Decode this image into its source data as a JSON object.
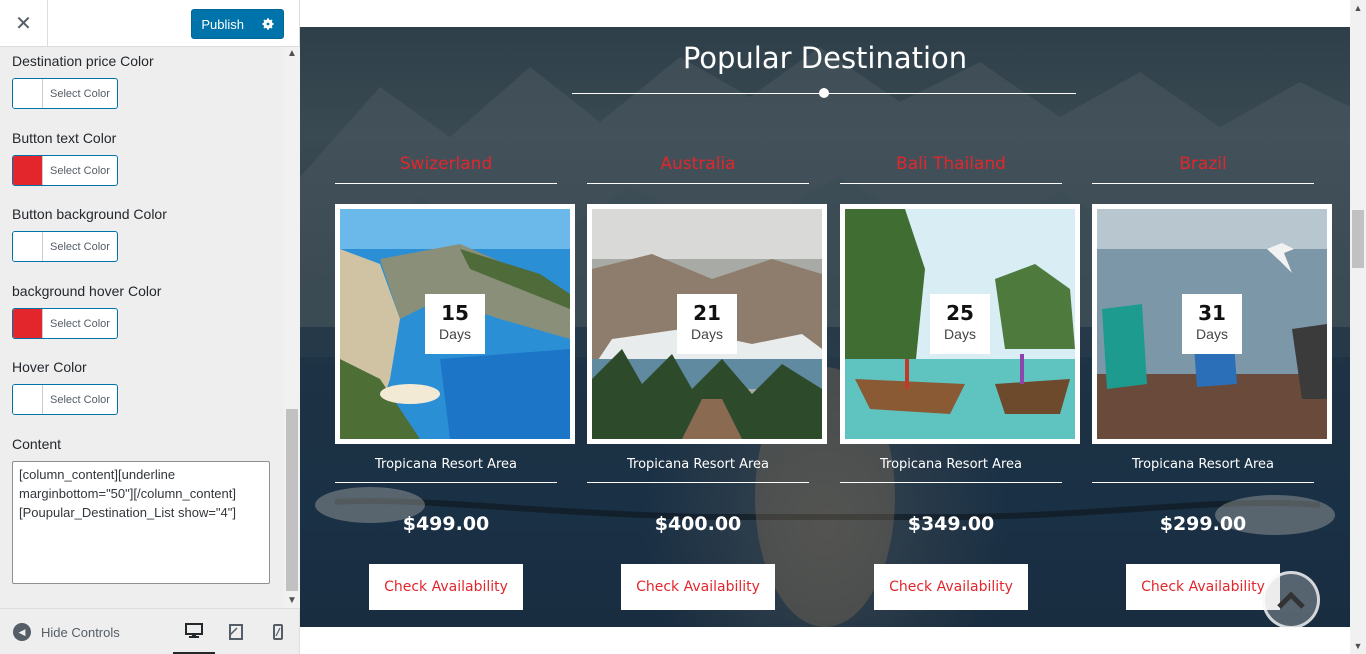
{
  "header": {
    "close_icon": "close-icon",
    "publish_label": "Publish",
    "publish_icon": "gear-icon"
  },
  "controls": [
    {
      "label": "Destination price Color",
      "button_label": "Select Color",
      "swatch_color": "#ffffff"
    },
    {
      "label": "Button text Color",
      "button_label": "Select Color",
      "swatch_color": "#e3262c"
    },
    {
      "label": "Button background Color",
      "button_label": "Select Color",
      "swatch_color": "#ffffff"
    },
    {
      "label": "background hover Color",
      "button_label": "Select Color",
      "swatch_color": "#e3262c"
    },
    {
      "label": "Hover Color",
      "button_label": "Select Color",
      "swatch_color": "#ffffff"
    }
  ],
  "content": {
    "label": "Content",
    "value": "[column_content][underline marginbottom=\"50\"][/column_content]\n[Poupular_Destination_List show=\"4\"]"
  },
  "footer": {
    "hide_controls_label": "Hide Controls",
    "devices": [
      "desktop-icon",
      "tablet-icon",
      "mobile-icon"
    ]
  },
  "preview": {
    "title": "Popular Destination",
    "accent_color": "#e3262c",
    "destinations": [
      {
        "name": "Swizerland",
        "days": "15",
        "days_label": "Days",
        "area": "Tropicana Resort Area",
        "price": "$499.00",
        "button": "Check Availability"
      },
      {
        "name": "Australia",
        "days": "21",
        "days_label": "Days",
        "area": "Tropicana Resort Area",
        "price": "$400.00",
        "button": "Check Availability"
      },
      {
        "name": "Bali Thailand",
        "days": "25",
        "days_label": "Days",
        "area": "Tropicana Resort Area",
        "price": "$349.00",
        "button": "Check Availability"
      },
      {
        "name": "Brazil",
        "days": "31",
        "days_label": "Days",
        "area": "Tropicana Resort Area",
        "price": "$299.00",
        "button": "Check Availability"
      }
    ]
  }
}
